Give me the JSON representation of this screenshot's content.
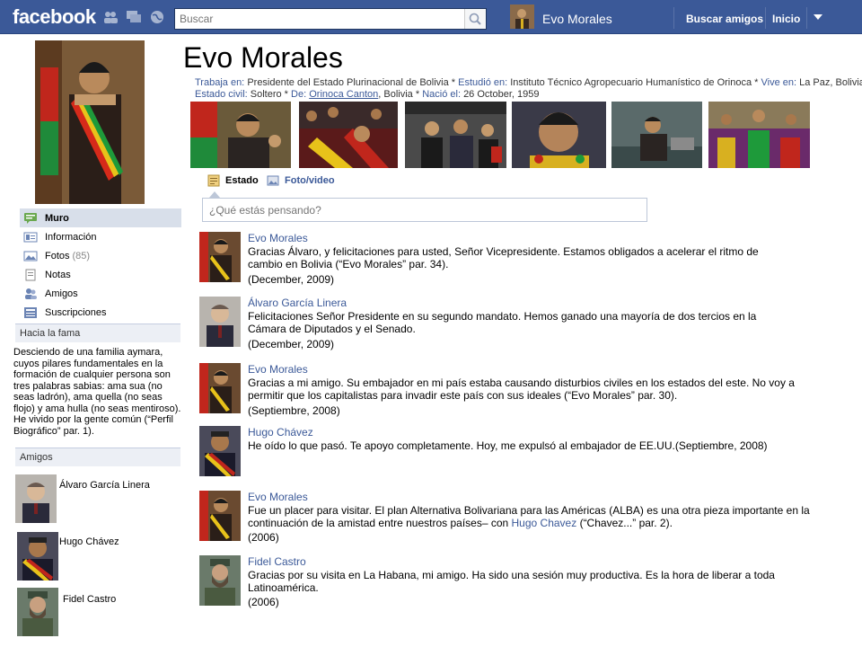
{
  "topbar": {
    "logo": "facebook",
    "search_placeholder": "Buscar",
    "user_name": "Evo Morales",
    "find_friends": "Buscar amigos",
    "home": "Inicio"
  },
  "profile": {
    "name": "Evo Morales",
    "info": {
      "works_label": "Trabaja en:",
      "works_value": "Presidente del Estado Plurinacional de Bolivia",
      "studied_label": "Estudió en:",
      "studied_value": "Instituto Técnico Agropecuario Humanístico de Orinoca",
      "lives_label": "Vive en:",
      "lives_value": "La Paz, Bolivia",
      "civil_label": "Estado civil:",
      "civil_value": "Soltero",
      "from_label": "De:",
      "from_link": "Orinoca Canton",
      "from_rest": ", Bolivia",
      "born_label": "Nació el:",
      "born_value": "26 October, 1959",
      "sep": " * "
    }
  },
  "sidebar": {
    "items": [
      {
        "label": "Muro",
        "count": ""
      },
      {
        "label": "Información",
        "count": ""
      },
      {
        "label": "Fotos",
        "count": "(85)"
      },
      {
        "label": "Notas",
        "count": ""
      },
      {
        "label": "Amigos",
        "count": ""
      },
      {
        "label": "Suscripciones",
        "count": ""
      }
    ],
    "fame_title": "Hacia la fama",
    "bio": "Desciendo de una familia aymara, cuyos pilares fundamentales en la formación de cualquier persona son tres palabras sabias: ama sua (no seas ladrón), ama quella (no seas flojo) y ama hulla (no seas mentiroso).  He vivido por la gente común (“Perfil Biográfico” par. 1).",
    "friends_title": "Amigos",
    "friends": [
      "Álvaro García Linera",
      "Hugo Chávez",
      "Fidel Castro"
    ]
  },
  "composer": {
    "tab_status": "Estado",
    "tab_photo": "Foto/video",
    "placeholder": "¿Qué estás pensando?"
  },
  "posts": [
    {
      "author": "Evo Morales",
      "text": "Gracias Álvaro, y felicitaciones para usted, Señor Vicepresidente.  Estamos obligados a acelerar el ritmo de cambio en Bolivia (“Evo Morales” par. 34).",
      "date": "(December, 2009)"
    },
    {
      "author": "Álvaro García Linera",
      "text": "Felicitaciones Señor Presidente en su segundo mandato.  Hemos ganado una mayoría de dos tercios en la Cámara de Diputados y el Senado.",
      "date": "(December, 2009)"
    },
    {
      "author": "Evo Morales",
      "text": "Gracias a mi amigo. Su embajador en mi país estaba causando disturbios civiles en los estados del este.  No voy a permitir que los capitalistas para invadir este país con sus ideales (“Evo Morales” par. 30).",
      "date": "(Septiembre, 2008)"
    },
    {
      "author": "Hugo Chávez",
      "text": "He oído lo que pasó. Te apoyo completamente. Hoy, me expulsó al embajador de EE.UU.(Septiembre, 2008)",
      "date": ""
    },
    {
      "author": "Evo Morales",
      "text_before": "Fue un placer para visitar. El plan Alternativa Bolivariana para las Américas (ALBA) es una otra pieza importante en la continuación de la amistad entre nuestros países– con ",
      "text_link": "Hugo Chavez",
      "text_after": " (“Chavez...” par. 2).",
      "date": "(2006)"
    },
    {
      "author": "Fidel Castro",
      "text": "Gracias por su visita en La Habana, mi amigo.  Ha sido una sesión muy productiva.  Es la hora de liberar a toda Latinoamérica.",
      "date": "(2006)"
    }
  ],
  "colors": {
    "brand": "#3b5998",
    "nav_active": "#d8dfea",
    "box_head": "#eceff5"
  }
}
